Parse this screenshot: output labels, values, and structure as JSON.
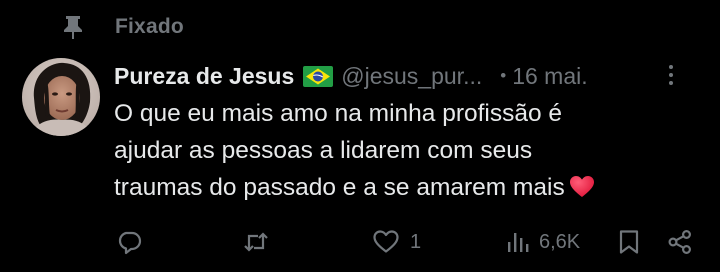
{
  "pinned": {
    "label": "Fixado",
    "icon": "pin-icon"
  },
  "post": {
    "author": {
      "display_name": "Pureza de Jesus",
      "flag_icon": "brazil-flag-icon",
      "handle": "@jesus_pur...",
      "separator": "•",
      "time": "16 mai."
    },
    "text_lines": [
      "O que eu mais amo na minha profissão é",
      "ajudar as pessoas a lidarem com seus",
      "traumas do passado e a se amarem mais"
    ],
    "trailing_emoji": "red-heart-icon",
    "actions": {
      "reply": {
        "icon": "reply-icon",
        "count": ""
      },
      "repost": {
        "icon": "repost-icon",
        "count": ""
      },
      "like": {
        "icon": "heart-icon",
        "count": "1"
      },
      "views": {
        "icon": "views-icon",
        "count": "6,6K"
      },
      "bookmark": {
        "icon": "bookmark-icon"
      },
      "share": {
        "icon": "share-icon"
      }
    }
  },
  "colors": {
    "background": "#000000",
    "primary_text": "#e7e9ea",
    "secondary_text": "#71767b",
    "heart_red": "#f91880"
  }
}
